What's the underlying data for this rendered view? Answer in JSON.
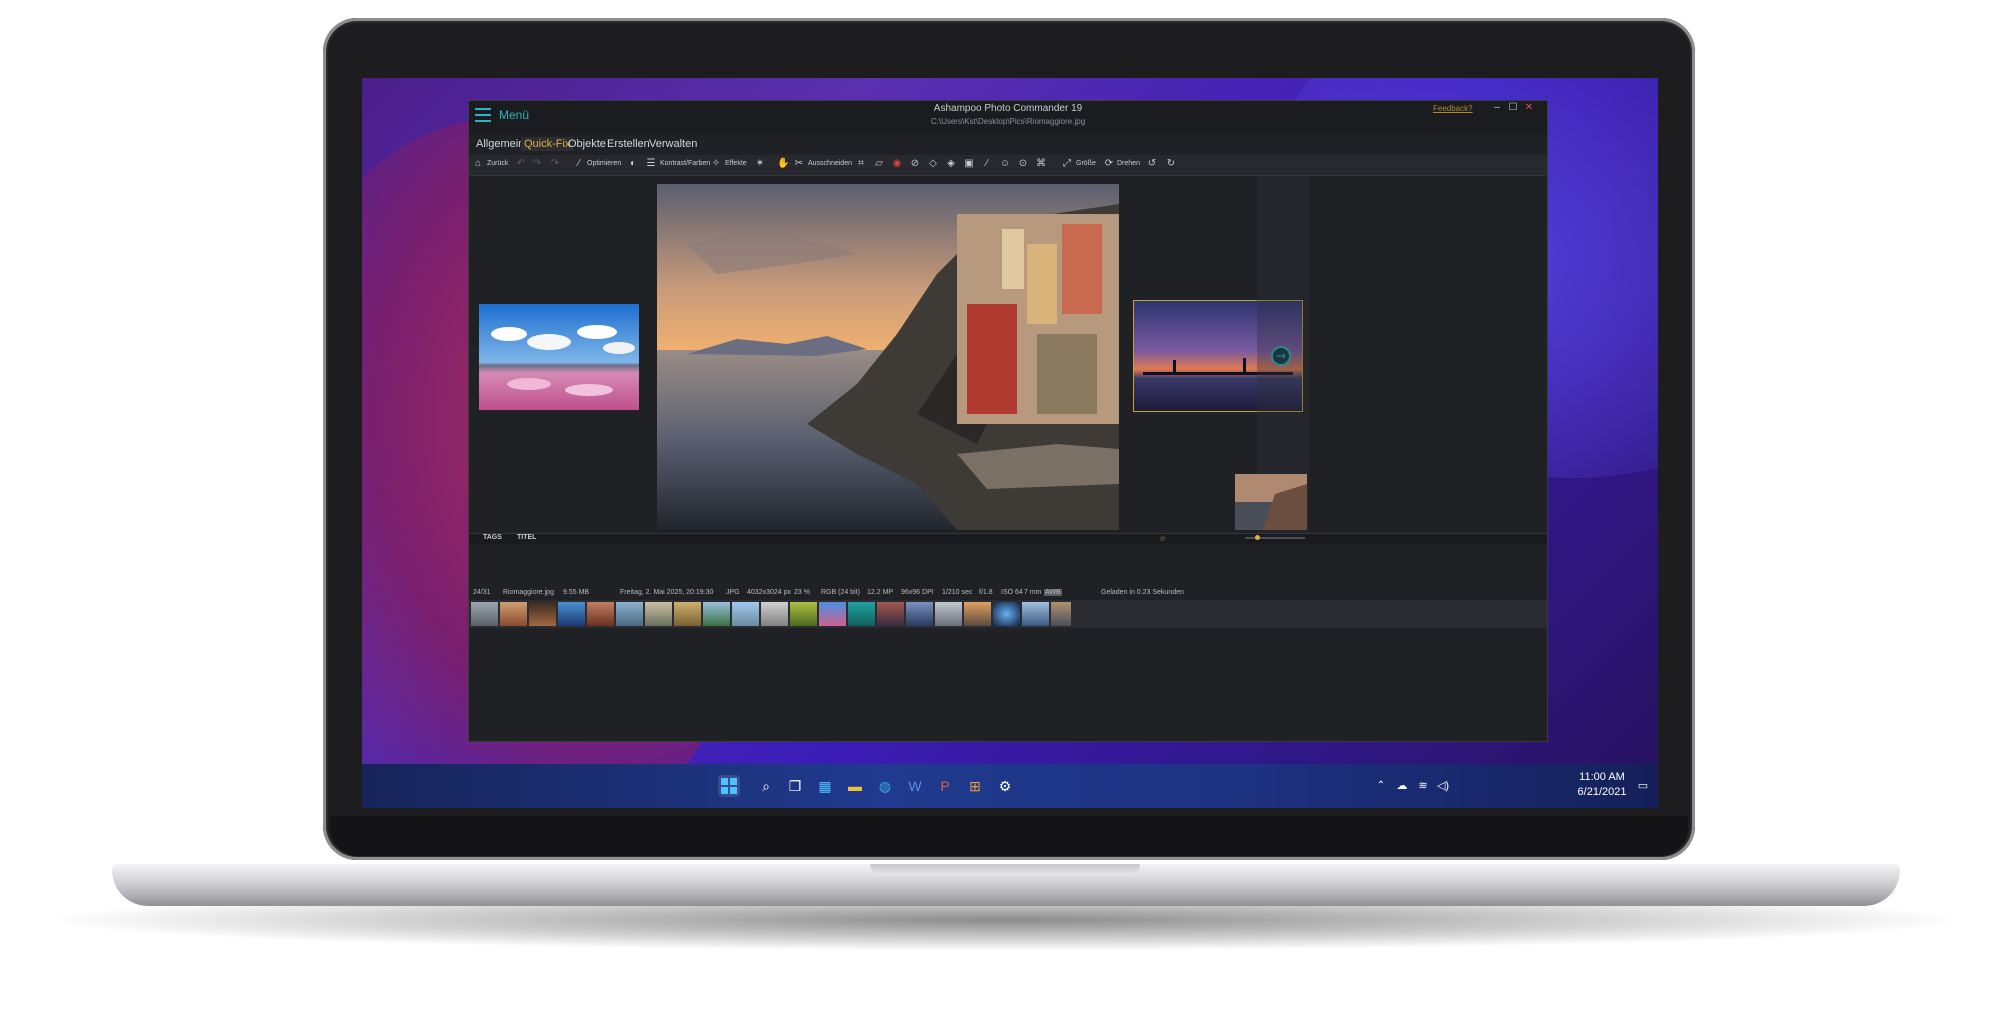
{
  "window": {
    "menu_label": "Menü",
    "title": "Ashampoo Photo Commander 19",
    "path": "C:\\Users\\Kst\\Desktop\\Pics\\Riomaggiore.jpg",
    "feedback": "Feedback?"
  },
  "tabs": [
    "Allgemein",
    "Quick-Fix",
    "Objekte",
    "Erstellen",
    "Verwalten"
  ],
  "active_tab": "Quick-Fix",
  "toolbar": {
    "back": "Zurück",
    "optimize": "Optimieren",
    "contrast": "Kontrast/Farben",
    "effects": "Effekte",
    "cut": "Ausschneiden",
    "size": "Größe",
    "rotate": "Drehen"
  },
  "bottom_tabs": {
    "tags": "TAGS",
    "title": "TITEL"
  },
  "status": {
    "index": "24/31",
    "filename": "Riomaggiore.jpg",
    "filesize": "9.55 MB",
    "date": "Freitag, 2. Mai 2025, 20:19:30",
    "format": "JPG",
    "dimensions": "4032x3024 px",
    "zoom": "23 %",
    "color": "RGB (24 bit)",
    "megapixels": "12.2 MP",
    "dpi": "96x96 DPI",
    "shutter": "1/210 sec",
    "aperture": "f/1.8",
    "iso": "ISO 64",
    "focal": "7 mm",
    "awb": "AWB",
    "loaded": "Geladen in 0.23 Sekunden"
  },
  "taskbar": {
    "time": "11:00 AM",
    "date": "6/21/2021"
  },
  "colors": {
    "accent_teal": "#2bb5c4",
    "accent_gold": "#e1b23a",
    "selected_border": "#c9a227"
  }
}
